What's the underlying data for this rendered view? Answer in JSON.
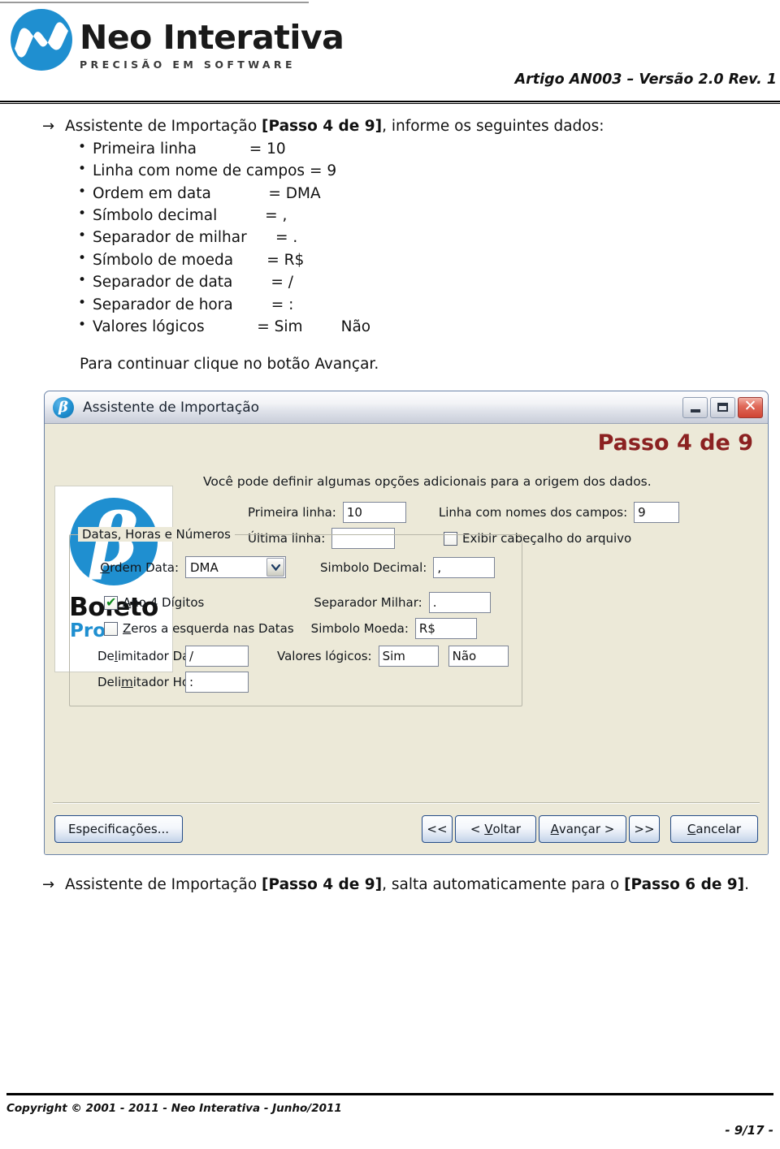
{
  "header": {
    "logo_icon": "neo-interativa-wave-logo",
    "brand": "Neo Interativa",
    "tagline": "PRECISÃO EM SOFTWARE",
    "article_ref": "Artigo AN003 – Versão 2.0 Rev. 1"
  },
  "intro": {
    "arrow": "→",
    "text_before": "Assistente de Importação ",
    "step_bold": "[Passo 4 de 9]",
    "text_after": ", informe os seguintes dados:"
  },
  "spec_list": [
    {
      "label": "Primeira linha",
      "pad": "           ",
      "value": "= 10"
    },
    {
      "label": "Linha com nome de campos",
      "pad": " ",
      "value": "= 9"
    },
    {
      "label": "Ordem em data",
      "pad": "            ",
      "value": "= DMA"
    },
    {
      "label": "Símbolo decimal",
      "pad": "          ",
      "value": "= ,"
    },
    {
      "label": "Separador de milhar",
      "pad": "      ",
      "value": "= ."
    },
    {
      "label": "Símbolo de moeda",
      "pad": "       ",
      "value": "= R$"
    },
    {
      "label": "Separador de data",
      "pad": "        ",
      "value": "= /"
    },
    {
      "label": "Separador de hora",
      "pad": "        ",
      "value": "= :"
    },
    {
      "label": "Valores lógicos",
      "pad": "           ",
      "value": "= Sim        Não"
    }
  ],
  "continue_text": "Para continuar clique no botão Avançar.",
  "dialog": {
    "icon": "beta-boleto-icon",
    "title": "Assistente de Importação",
    "window_buttons": {
      "minimize": "minimize-icon",
      "maximize": "maximize-icon",
      "close": "close-icon"
    },
    "step_badge": "Passo 4 de 9",
    "intro": "Você pode definir algumas opções adicionais para a origem dos dados.",
    "side_image": {
      "product": "Boleto",
      "edition": "Pro",
      "symbol": "β"
    },
    "fields": {
      "primeira_linha_label": "Primeira linha:",
      "primeira_linha_value": "10",
      "ultima_linha_label": "Última linha:",
      "ultima_linha_value": "",
      "linha_nomes_label": "Linha com nomes dos campos:",
      "linha_nomes_value": "9",
      "exibir_cabecalho_label": "Exibir cabeçalho do arquivo",
      "exibir_cabecalho_checked": false
    },
    "group": {
      "title": "Datas, Horas e Números",
      "ordem_data_label": "Ordem Data:",
      "ordem_data_value": "DMA",
      "ordem_data_options": [
        "DMA"
      ],
      "ano4_label": "Ano 4 Dígitos",
      "ano4_checked": true,
      "zeros_label": "Zeros a esquerda nas Datas",
      "zeros_checked": false,
      "delim_data_label": "Delimitador Data:",
      "delim_data_value": "/",
      "delim_hora_label": "Delimitador Hora:",
      "delim_hora_value": ":",
      "simbolo_decimal_label": "Simbolo Decimal:",
      "simbolo_decimal_value": ",",
      "separador_milhar_label": "Separador Milhar:",
      "separador_milhar_value": ".",
      "simbolo_moeda_label": "Simbolo Moeda:",
      "simbolo_moeda_value": "R$",
      "valores_logicos_label": "Valores lógicos:",
      "valores_logicos_sim": "Sim",
      "valores_logicos_nao": "Não"
    },
    "buttons": {
      "especificacoes": "Especificações...",
      "first": "<<",
      "back": "< Voltar",
      "next": "Avançar >",
      "last": ">>",
      "cancel": "Cancelar"
    }
  },
  "post_note": {
    "arrow": "→",
    "text_before": "Assistente de Importação ",
    "step_bold": "[Passo 4 de 9]",
    "text_middle": ", salta automaticamente para o ",
    "step_bold2": "[Passo 6 de 9]",
    "text_after": "."
  },
  "footer": {
    "copyright": "Copyright © 2001 - 2011 - Neo Interativa - Junho/2011",
    "page_number": "- 9/17 -"
  },
  "colors": {
    "brand_blue": "#1f8fd0",
    "step_red": "#8b2121",
    "dialog_face": "#ece9d8"
  }
}
